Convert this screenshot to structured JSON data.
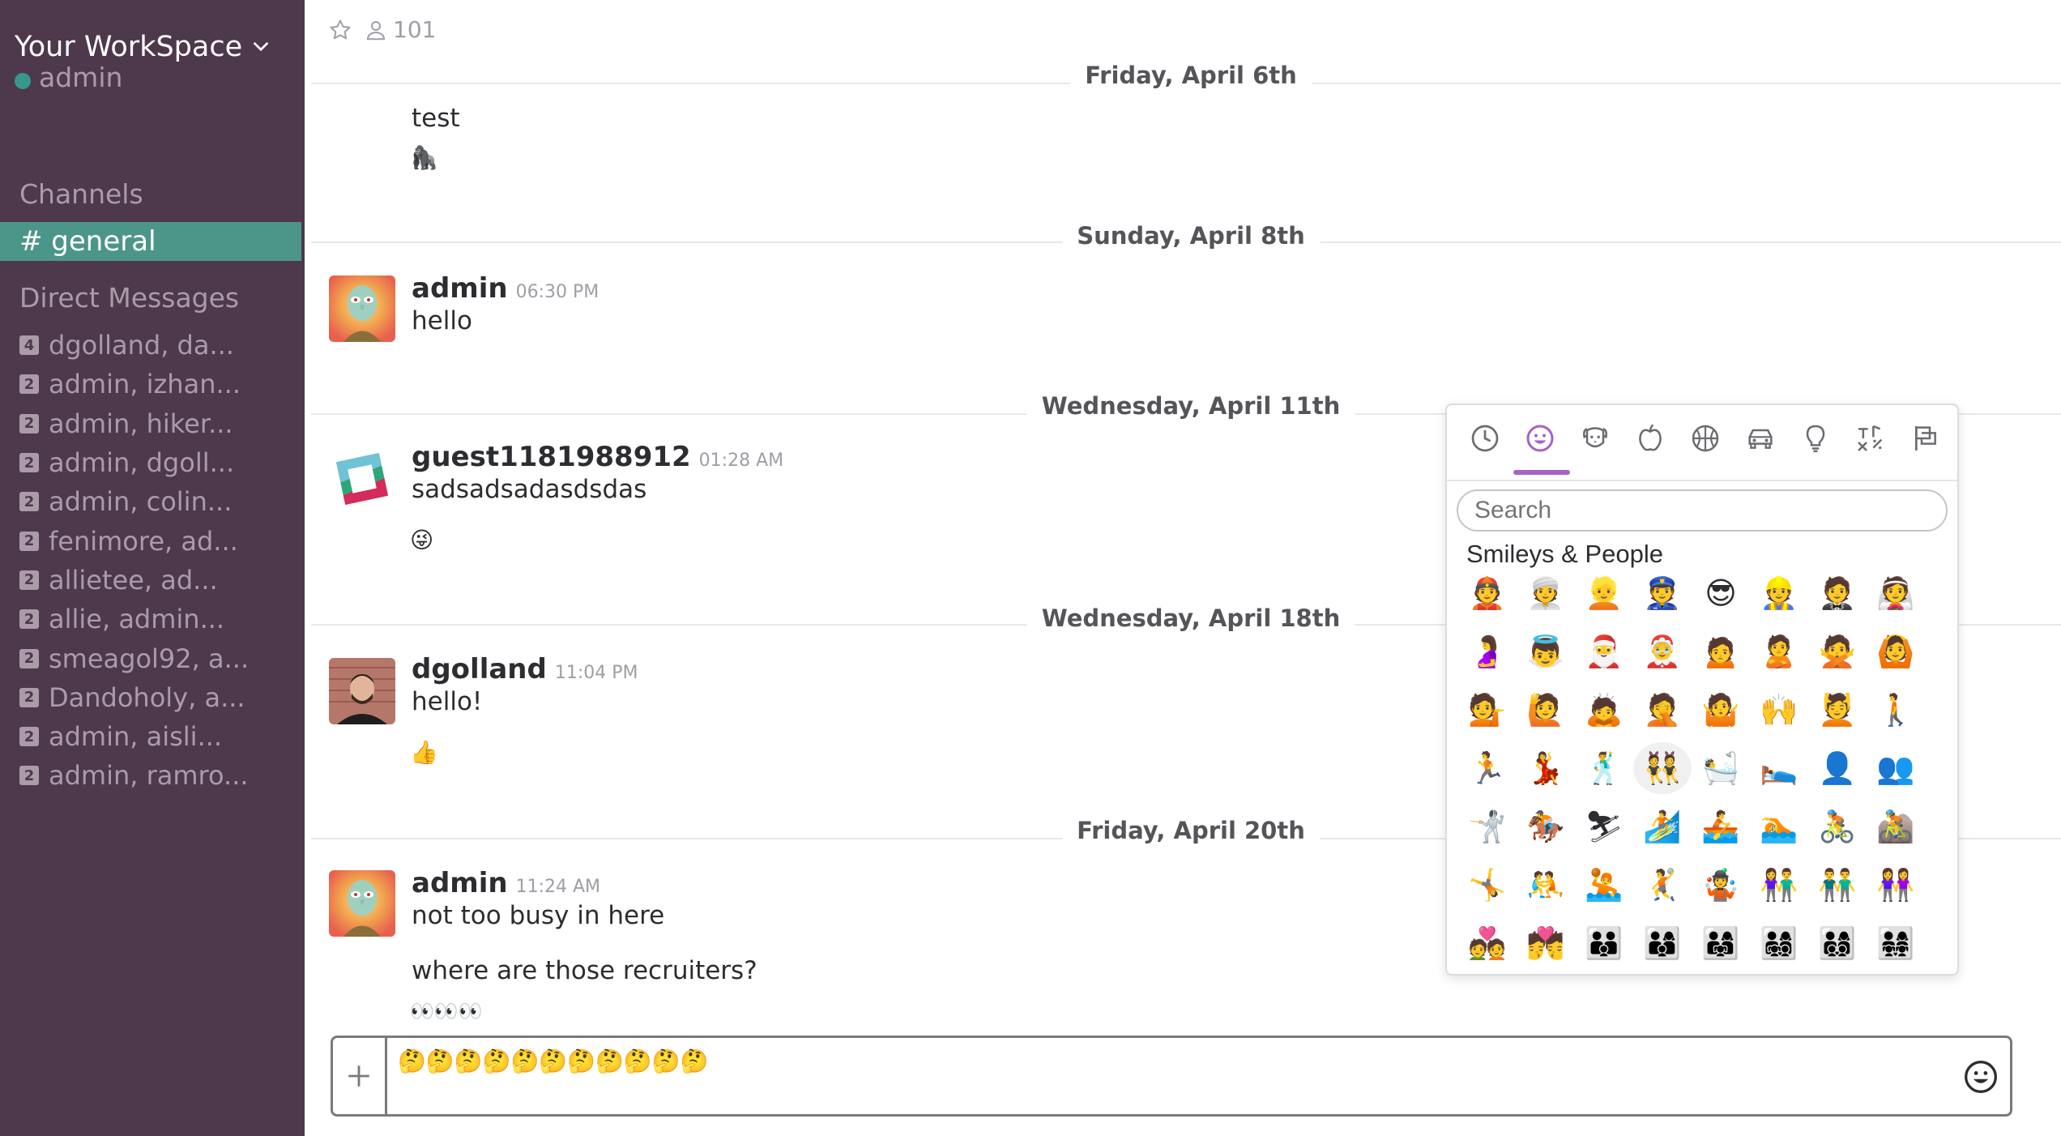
{
  "sidebar": {
    "workspace_name": "Your WorkSpace",
    "current_user": "admin",
    "channels_title": "Channels",
    "active_channel": "# general",
    "dm_title": "Direct Messages",
    "dms": [
      {
        "count": "4",
        "label": "dgolland, da..."
      },
      {
        "count": "2",
        "label": "admin, izhan..."
      },
      {
        "count": "2",
        "label": "admin, hiker..."
      },
      {
        "count": "2",
        "label": "admin, dgoll..."
      },
      {
        "count": "2",
        "label": "admin, colin..."
      },
      {
        "count": "2",
        "label": "fenimore, ad..."
      },
      {
        "count": "2",
        "label": "allietee, ad..."
      },
      {
        "count": "2",
        "label": "allie, admin..."
      },
      {
        "count": "2",
        "label": "smeagol92, a..."
      },
      {
        "count": "2",
        "label": "Dandoholy, a..."
      },
      {
        "count": "2",
        "label": "admin, aisli..."
      },
      {
        "count": "2",
        "label": "admin, ramro..."
      }
    ]
  },
  "header": {
    "member_count": "101"
  },
  "days": [
    {
      "label": "Friday, April 6th"
    },
    {
      "label": "Sunday, April 8th"
    },
    {
      "label": "Wednesday, April 11th"
    },
    {
      "label": "Wednesday, April 18th"
    },
    {
      "label": "Friday, April 20th"
    }
  ],
  "messages": [
    {
      "text": "test",
      "emoji": "🦍"
    },
    {
      "author": "admin",
      "time": "06:30 PM",
      "text": "hello"
    },
    {
      "author": "guest1181988912",
      "time": "01:28 AM",
      "text": "sadsadsadasdsdas",
      "emoji": "😜"
    },
    {
      "author": "dgolland",
      "time": "11:04 PM",
      "text": "hello!",
      "emoji": "👍"
    },
    {
      "author": "admin",
      "time": "11:24 AM",
      "text": "not too busy in here",
      "text2": "where are those recruiters?",
      "emoji": "👀👀👀"
    }
  ],
  "composer": {
    "text": "🤔🤔🤔🤔🤔🤔🤔🤔🤔🤔🤔"
  },
  "emoji_picker": {
    "tabs": [
      "recent-icon",
      "smileys-icon",
      "animals-icon",
      "food-icon",
      "activity-icon",
      "travel-icon",
      "objects-icon",
      "symbols-icon",
      "flags-icon"
    ],
    "search_placeholder": "Search",
    "section_title": "Smileys & People",
    "rows": [
      [
        "👲",
        "👳",
        "👱",
        "👮",
        "😎",
        "👷",
        "🤵",
        "👰"
      ],
      [
        "🤰",
        "👼",
        "🎅",
        "🤶",
        "🙍",
        "🙎",
        "🙅",
        "🙆"
      ],
      [
        "💁",
        "🙋",
        "🙇",
        "🤦",
        "🤷",
        "🙌",
        "💆",
        "🚶"
      ],
      [
        "🏃",
        "💃",
        "🕺",
        "👯",
        "🛀",
        "🛌",
        "👤",
        "👥"
      ],
      [
        "🤺",
        "🏇",
        "⛷",
        "🏄",
        "🚣",
        "🏊",
        "🚴",
        "🚵"
      ],
      [
        "🤸",
        "🤼",
        "🤽",
        "🤾",
        "🤹",
        "👫",
        "👬",
        "👭"
      ],
      [
        "💑",
        "💏",
        "👪",
        "👨‍👩‍👦",
        "👨‍👩‍👧",
        "👨‍👩‍👧‍👦",
        "👨‍👩‍👦‍👦",
        "👨‍👩‍👧‍👧"
      ]
    ]
  },
  "colors": {
    "sidebar_bg": "#4d394b",
    "active_channel_bg": "#4c9689",
    "picker_accent": "#a463c7"
  }
}
